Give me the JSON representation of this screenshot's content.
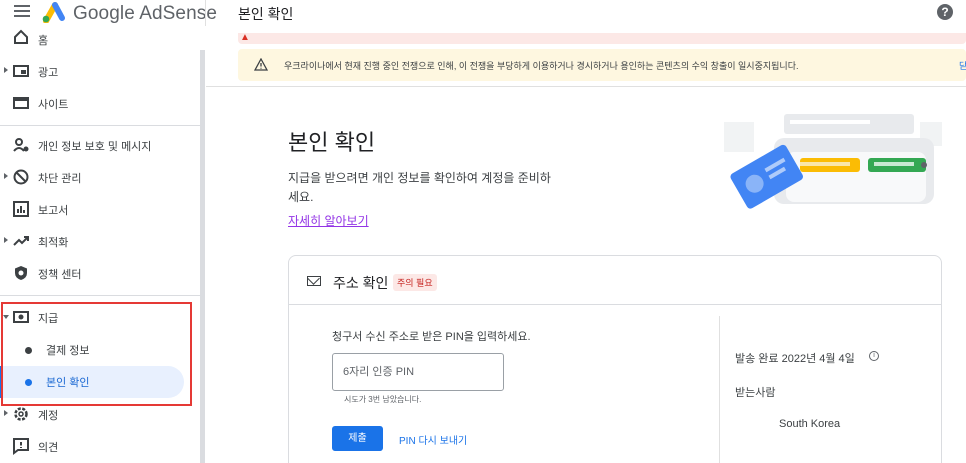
{
  "header": {
    "brand": "Google AdSense",
    "page_title": "본인 확인",
    "help": "?"
  },
  "sidebar": {
    "items": [
      {
        "label": "홈",
        "icon": "home-icon"
      },
      {
        "label": "광고",
        "icon": "ads-icon"
      },
      {
        "label": "사이트",
        "icon": "sites-icon"
      },
      {
        "label": "개인 정보 보호 및 메시지",
        "icon": "privacy-icon"
      },
      {
        "label": "차단 관리",
        "icon": "block-icon"
      },
      {
        "label": "보고서",
        "icon": "reports-icon"
      },
      {
        "label": "최적화",
        "icon": "optimize-icon"
      },
      {
        "label": "정책 센터",
        "icon": "policy-icon"
      },
      {
        "label": "지급",
        "icon": "payments-icon"
      },
      {
        "label": "결제 정보"
      },
      {
        "label": "본인 확인"
      },
      {
        "label": "계정",
        "icon": "gear-icon"
      },
      {
        "label": "의견",
        "icon": "feedback-icon"
      }
    ]
  },
  "alerts": {
    "warning": "우크라이나에서 현재 진행 중인 전쟁으로 인해, 이 전쟁을 부당하게 이용하거나 경시하거나 용인하는 콘텐츠의 수익 창출이 일시중지됩니다.",
    "dismiss": "닫"
  },
  "main": {
    "title": "본인 확인",
    "description": "지급을 받으려면 개인 정보를 확인하여 계정을 준비하세요.",
    "learn_more": "자세히 알아보기"
  },
  "card": {
    "title": "주소 확인",
    "badge": "주의 필요",
    "instruction": "청구서 수신 주소로 받은 PIN을 입력하세요.",
    "pin_placeholder": "6자리 인증 PIN",
    "attempts_hint": "시도가 3번 남았습니다.",
    "submit_label": "제출",
    "resend_label": "PIN 다시 보내기",
    "sent_status": "발송 완료 2022년 4월 4일",
    "recipient_label": "받는사람",
    "country": "South Korea"
  },
  "colors": {
    "accent": "#1a73e8",
    "highlight_box": "#e53935",
    "warning_bg": "#fef7e0",
    "error_bg": "#fce8e6"
  }
}
